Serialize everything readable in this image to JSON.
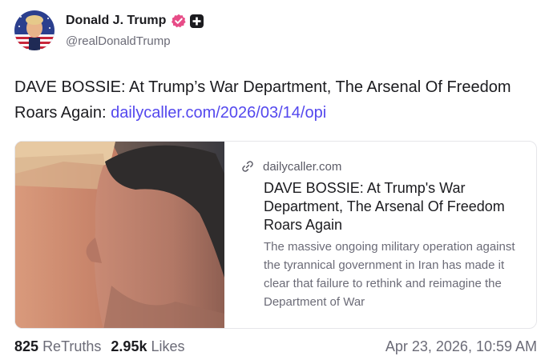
{
  "author": {
    "name": "Donald J. Trump",
    "handle": "@realDonaldTrump",
    "verified_icon": "verified-badge-icon",
    "plus_icon": "plus-icon"
  },
  "post": {
    "text": "DAVE BOSSIE: At Trump’s War Department, The Arsenal Of Freedom Roars Again: ",
    "link_text": "dailycaller.com/2026/03/14/opi"
  },
  "link_card": {
    "domain": "dailycaller.com",
    "title": "DAVE BOSSIE: At Trump's War Department, The Arsenal Of Freedom Roars Again",
    "description": "The massive ongoing military operation against the tyrannical government in Iran has made it clear that failure to rethink and reimagine the Department of War"
  },
  "stats": {
    "retruths_count": "825",
    "retruths_label": "ReTruths",
    "likes_count": "2.95k",
    "likes_label": "Likes"
  },
  "timestamp": "Apr 23, 2026, 10:59 AM",
  "colors": {
    "link": "#5448ee",
    "verified": "#e74c87",
    "muted_text": "#6b6b77"
  }
}
